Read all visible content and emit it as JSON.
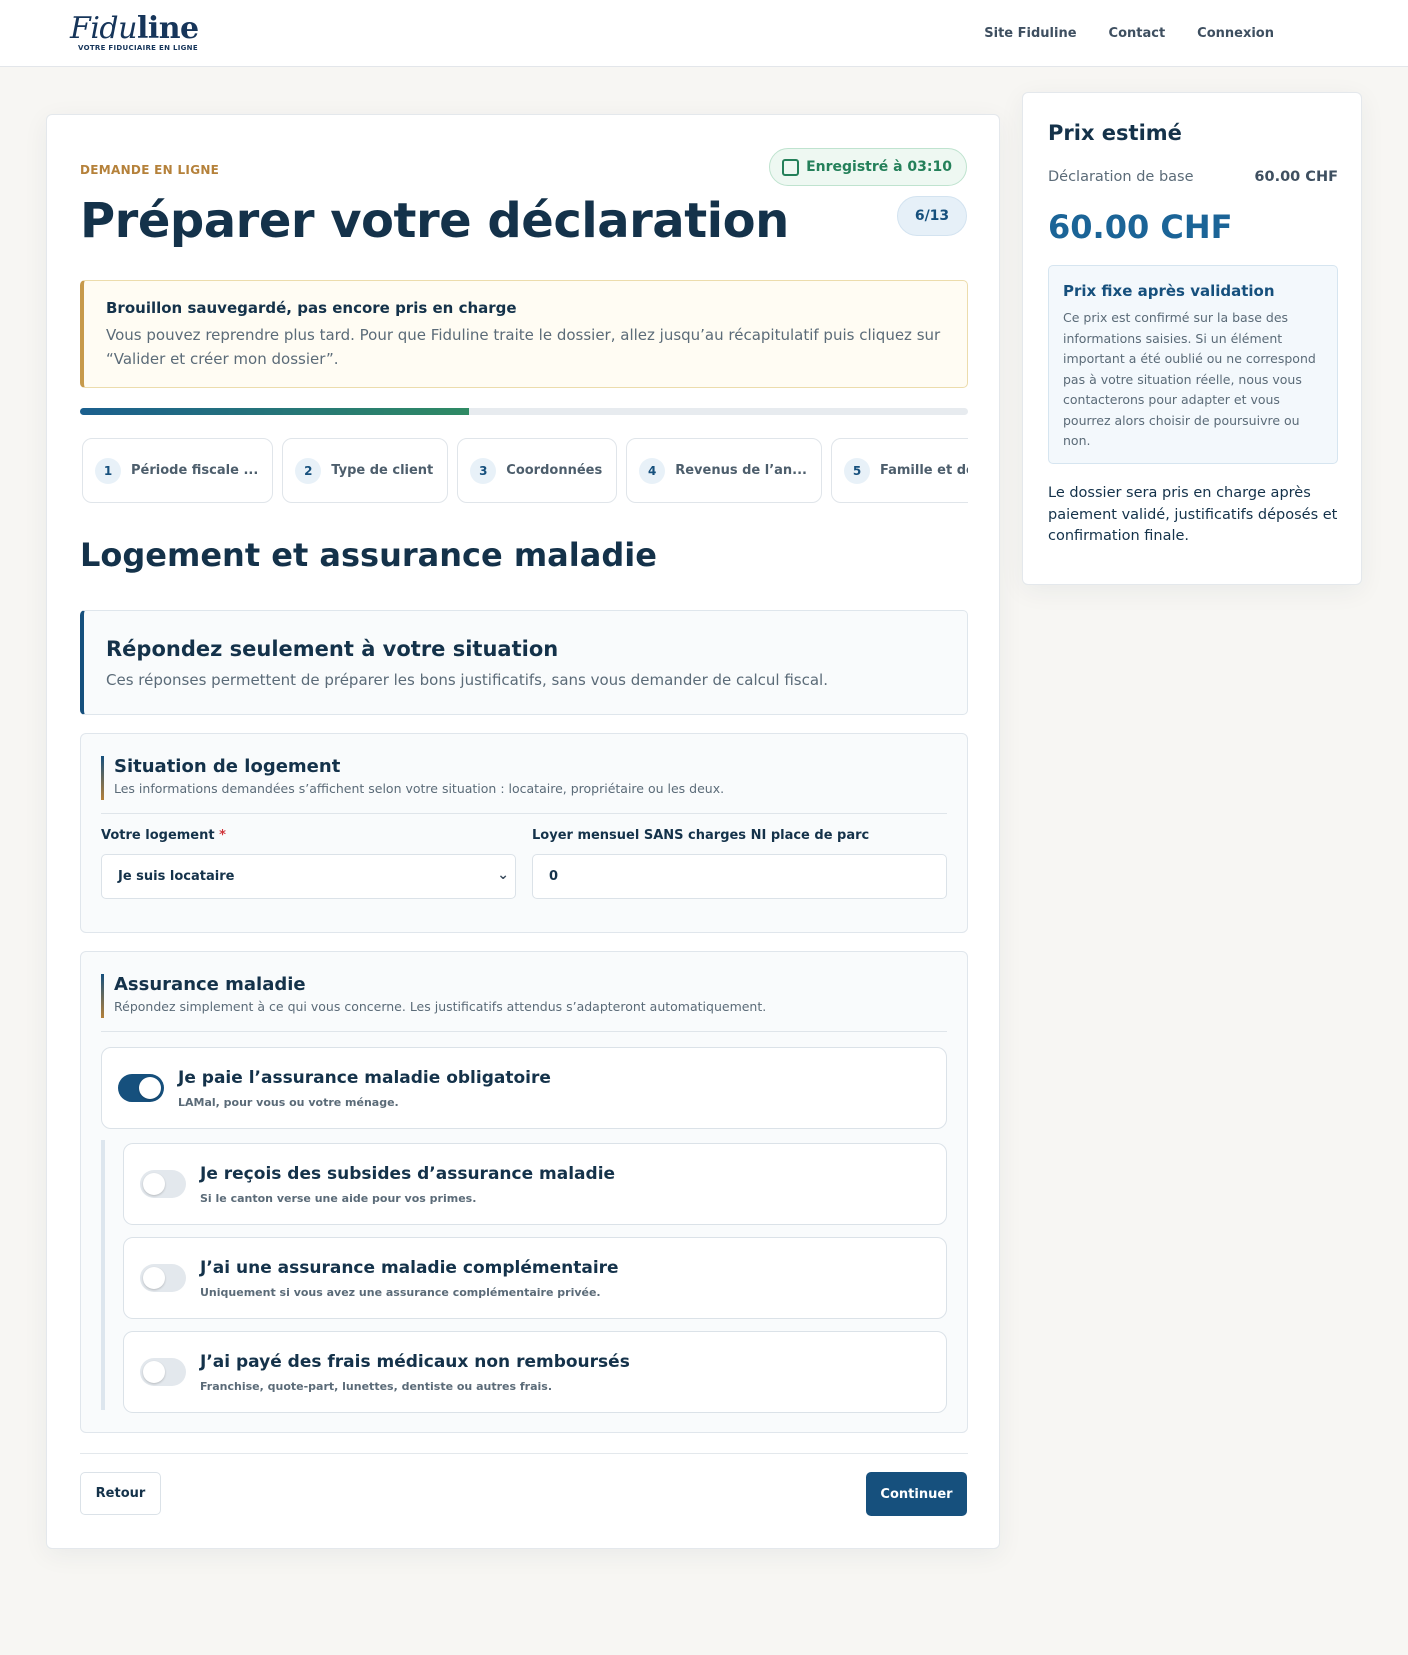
{
  "header": {
    "logo_left": "Fidu",
    "logo_right": "line",
    "logo_tagline": "VOTRE FIDUCIAIRE EN LIGNE",
    "nav": [
      "Site Fiduline",
      "Contact",
      "Connexion"
    ]
  },
  "form": {
    "eyebrow": "DEMANDE EN LIGNE",
    "title": "Préparer votre déclaration",
    "saved_status": "Enregistré à 03:10",
    "step_counter": "6/13",
    "progress_fraction": 0.4375,
    "notice": {
      "title": "Brouillon sauvegardé, pas encore pris en charge",
      "text": "Vous pouvez reprendre plus tard. Pour que Fiduline traite le dossier, allez jusqu’au récapitulatif puis cliquez sur “Valider et créer mon dossier”."
    },
    "steps": [
      {
        "num": "1",
        "label": "Période fiscale ..."
      },
      {
        "num": "2",
        "label": "Type de client"
      },
      {
        "num": "3",
        "label": "Coordonnées"
      },
      {
        "num": "4",
        "label": "Revenus de l’an..."
      },
      {
        "num": "5",
        "label": "Famille et dépen..."
      }
    ],
    "section_title": "Logement et assurance maladie",
    "intro": {
      "title": "Répondez seulement à votre situation",
      "text": "Ces réponses permettent de préparer les bons justificatifs, sans vous demander de calcul fiscal."
    },
    "logement": {
      "title": "Situation de logement",
      "subtitle": "Les informations demandées s’affichent selon votre situation : locataire, propriétaire ou les deux.",
      "housing_label": "Votre logement",
      "required_mark": "*",
      "housing_value": "Je suis locataire",
      "rent_label": "Loyer mensuel SANS charges NI place de parc",
      "rent_value": "0"
    },
    "assurance": {
      "title": "Assurance maladie",
      "subtitle": "Répondez simplement à ce qui vous concerne. Les justificatifs attendus s’adapteront automatiquement.",
      "main_toggle": {
        "title": "Je paie l’assurance maladie obligatoire",
        "hint": "LAMal, pour vous ou votre ménage.",
        "on": true
      },
      "sub_toggles": [
        {
          "title": "Je reçois des subsides d’assurance maladie",
          "hint": "Si le canton verse une aide pour vos primes.",
          "on": false
        },
        {
          "title": "J’ai une assurance maladie complémentaire",
          "hint": "Uniquement si vous avez une assurance complémentaire privée.",
          "on": false
        },
        {
          "title": "J’ai payé des frais médicaux non remboursés",
          "hint": "Franchise, quote-part, lunettes, dentiste ou autres frais.",
          "on": false
        }
      ]
    },
    "buttons": {
      "back": "Retour",
      "next": "Continuer"
    }
  },
  "price": {
    "title": "Prix estimé",
    "base_label": "Déclaration de base",
    "base_value": "60.00 CHF",
    "total": "60.00 CHF",
    "box_title": "Prix fixe après validation",
    "box_text": "Ce prix est confirmé sur la base des informations saisies. Si un élément important a été oublié ou ne correspond pas à votre situation réelle, nous vous contacterons pour adapter et vous pourrez alors choisir de poursuivre ou non.",
    "note": "Le dossier sera pris en charge après paiement validé, justificatifs déposés et confirmation finale."
  }
}
